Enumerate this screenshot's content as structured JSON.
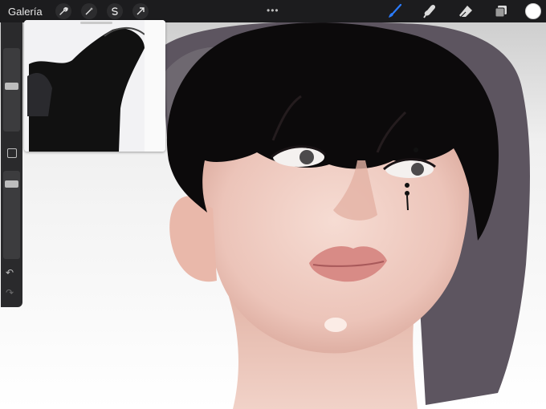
{
  "app": {
    "gallery_label": "Galería"
  },
  "toolbar": {
    "left_tools": [
      "wrench-icon",
      "magic-wand-icon",
      "selection-icon",
      "transform-arrow-icon"
    ],
    "right_tools": [
      "brush-icon",
      "smudge-icon",
      "eraser-icon",
      "layers-icon",
      "color-icon"
    ],
    "grip": "•••",
    "active_tool": "brush-icon"
  },
  "sidebar": {
    "brush_size_level": 0.55,
    "opacity_level": 0.9,
    "undo_glyph": "↶",
    "redo_glyph": "↷"
  },
  "colors": {
    "topbar": "#1c1c1e",
    "active_tool_accent": "#2b7cff",
    "current_color": "#ffffff"
  }
}
